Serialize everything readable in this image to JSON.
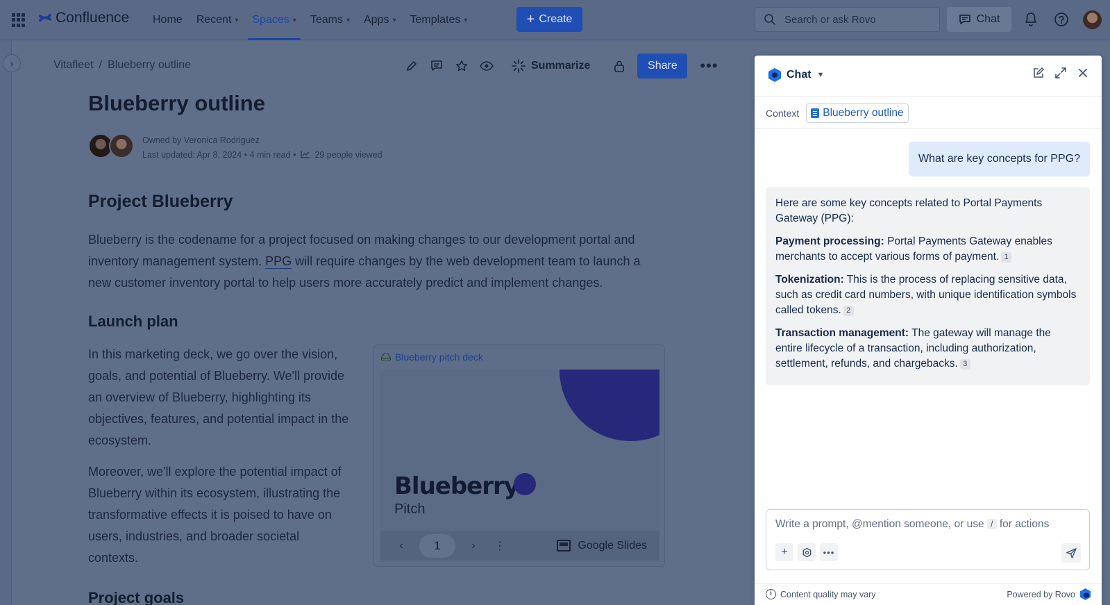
{
  "topnav": {
    "brand": "Confluence",
    "items": [
      {
        "label": "Home",
        "has_menu": false,
        "active": false
      },
      {
        "label": "Recent",
        "has_menu": true,
        "active": false
      },
      {
        "label": "Spaces",
        "has_menu": true,
        "active": true
      },
      {
        "label": "Teams",
        "has_menu": true,
        "active": false
      },
      {
        "label": "Apps",
        "has_menu": true,
        "active": false
      },
      {
        "label": "Templates",
        "has_menu": true,
        "active": false
      }
    ],
    "create_label": "Create",
    "search_placeholder": "Search or ask Rovo",
    "chat_label": "Chat"
  },
  "breadcrumb": {
    "space": "Vitafleet",
    "separator": "/",
    "page": "Blueberry outline"
  },
  "page_toolbar": {
    "summarize_label": "Summarize",
    "share_label": "Share"
  },
  "page": {
    "title": "Blueberry outline",
    "owner_prefix": "Owned by",
    "owner": "Veronica Rodriguez",
    "last_updated": "Last updated: Apr 8, 2024",
    "read_time": "4 min read",
    "viewers": "29 people viewed",
    "section1_heading": "Project Blueberry",
    "section1_lines": [
      "Blueberry is the codename for a project focused on making changes to our development portal and",
      "inventory management system.",
      "PPG",
      "will require changes by the web development team to launch a",
      "new customer inventory portal to help users more accurately predict and implement changes."
    ],
    "section2_heading": "Launch plan",
    "launch_para1": [
      "In this marketing deck, we go over the vision,",
      "goals, and potential of Blueberry. We'll provide",
      "an overview of Blueberry, highlighting its",
      "objectives, features, and potential impact in the",
      "ecosystem."
    ],
    "launch_para2": [
      "Moreover, we'll explore the potential impact of",
      "Blueberry within its ecosystem, illustrating the",
      "transformative effects it is poised to have on",
      "users, industries, and broader societal",
      "contexts."
    ],
    "section3_heading": "Project goals"
  },
  "embed": {
    "link_label": "Blueberry pitch deck",
    "slide_title": "Blueberry",
    "slide_subtitle": "Pitch",
    "page_number": "1",
    "provider": "Google Slides"
  },
  "chat": {
    "title": "Chat",
    "context_label": "Context",
    "context_chip": "Blueberry outline",
    "user_message": "What are key concepts for PPG?",
    "response": {
      "intro": "Here are some key concepts related to Portal Payments Gateway (PPG):",
      "items": [
        {
          "term": "Payment processing:",
          "text": "Portal Payments Gateway enables merchants to accept various forms of payment.",
          "cite": "1"
        },
        {
          "term": "Tokenization:",
          "text": "This is the process of replacing sensitive data, such as credit card numbers, with unique identification symbols called tokens.",
          "cite": "2"
        },
        {
          "term": "Transaction management:",
          "text": "The gateway will manage the entire lifecycle of a transaction, including authorization, settlement, refunds, and chargebacks.",
          "cite": "3"
        }
      ]
    },
    "composer_text_before": "Write a prompt, @mention someone, or use",
    "composer_slash": "/",
    "composer_text_after": "for actions",
    "footer_left": "Content quality may vary",
    "footer_right": "Powered by Rovo"
  },
  "colors": {
    "primary": "#1f4eb4",
    "active_nav": "#1e43a8",
    "chat_user_bubble": "#dfeafd",
    "chat_bot_bubble": "#f1f2f4",
    "slide_accent": "#26287a"
  }
}
